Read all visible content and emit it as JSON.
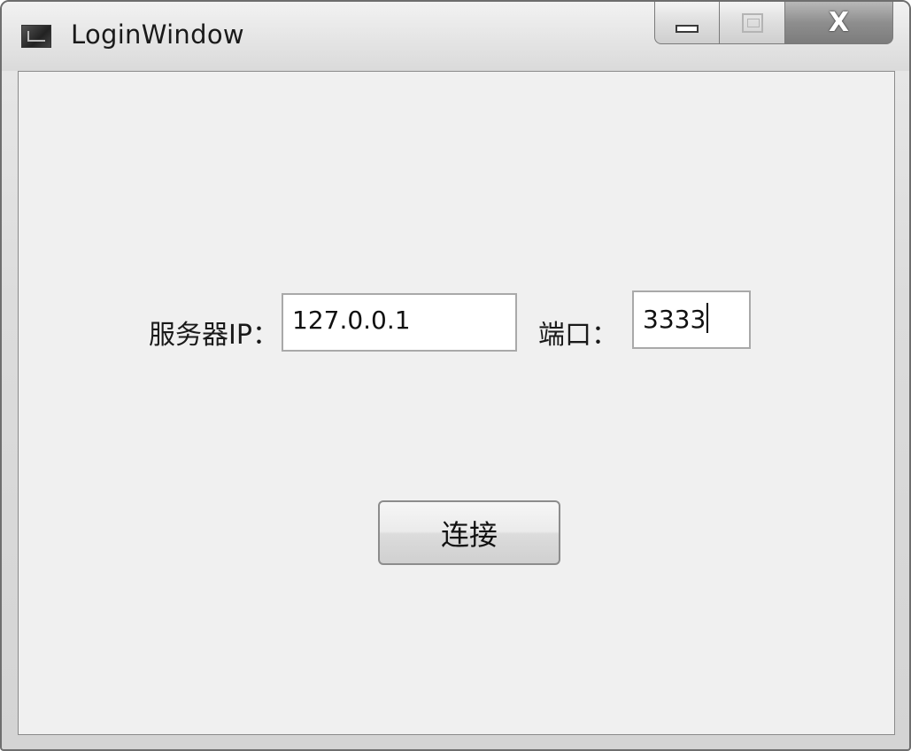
{
  "window": {
    "title": "LoginWindow",
    "icon": "app-window-icon",
    "caption": {
      "minimize_icon": "minimize-icon",
      "maximize_icon": "maximize-icon",
      "close_label": "X"
    }
  },
  "form": {
    "server_ip_label": "服务器IP：",
    "server_ip_value": "127.0.0.1",
    "port_label": "端口：",
    "port_value": "3333",
    "connect_label": "连接"
  }
}
